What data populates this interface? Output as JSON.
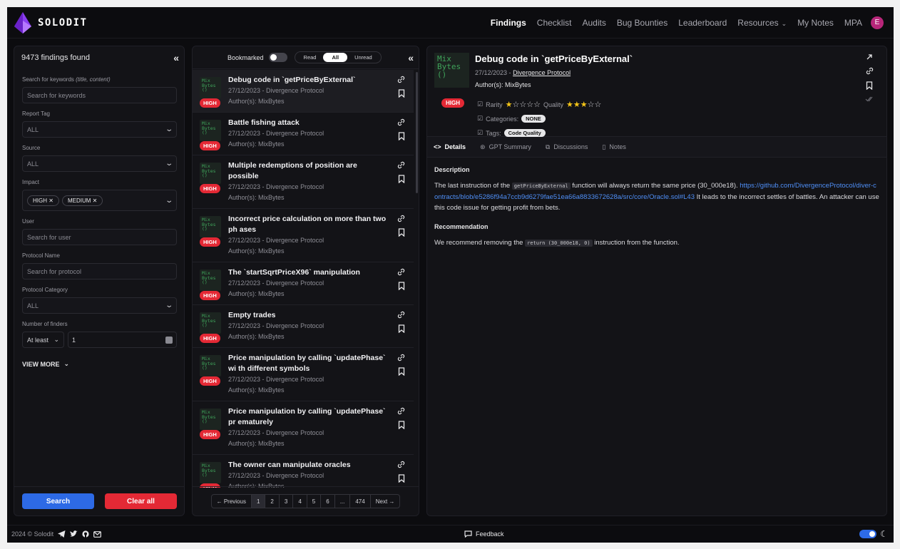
{
  "nav": {
    "brand": "SOLODIT",
    "items": [
      {
        "label": "Findings",
        "active": true
      },
      {
        "label": "Checklist"
      },
      {
        "label": "Audits"
      },
      {
        "label": "Bug Bounties"
      },
      {
        "label": "Leaderboard"
      },
      {
        "label": "Resources",
        "dropdown": true
      },
      {
        "label": "My Notes"
      },
      {
        "label": "MPA"
      }
    ],
    "avatar": "E"
  },
  "filters": {
    "count": "9473 findings found",
    "keywords_label": "Search for keywords",
    "keywords_hint": "(title, content)",
    "keywords_placeholder": "Search for keywords",
    "report_tag_label": "Report Tag",
    "report_tag_value": "ALL",
    "source_label": "Source",
    "source_value": "ALL",
    "impact_label": "Impact",
    "impact_chips": [
      "HIGH ✕",
      "MEDIUM ✕"
    ],
    "user_label": "User",
    "user_placeholder": "Search for user",
    "protocol_label": "Protocol Name",
    "protocol_placeholder": "Search for protocol",
    "category_label": "Protocol Category",
    "category_value": "ALL",
    "finders_label": "Number of finders",
    "finders_mode": "At least",
    "finders_value": "1",
    "view_more": "VIEW MORE",
    "search_button": "Search",
    "clear_button": "Clear all"
  },
  "list": {
    "bookmarked_label": "Bookmarked",
    "seg": [
      "Read",
      "All",
      "Unread"
    ],
    "logo_text": "Mix Bytes ()",
    "high_label": "HIGH",
    "rows": [
      {
        "title": "Debug code in `getPriceByExternal`",
        "date": "27/12/2023 - Divergence Protocol",
        "author": "Author(s): MixBytes"
      },
      {
        "title": "Battle fishing attack",
        "date": "27/12/2023 - Divergence Protocol",
        "author": "Author(s): MixBytes"
      },
      {
        "title": "Multiple redemptions of position are possible",
        "date": "27/12/2023 - Divergence Protocol",
        "author": "Author(s): MixBytes"
      },
      {
        "title": "Incorrect price calculation on more than two ph ases",
        "date": "27/12/2023 - Divergence Protocol",
        "author": "Author(s): MixBytes"
      },
      {
        "title": "The `startSqrtPriceX96` manipulation",
        "date": "27/12/2023 - Divergence Protocol",
        "author": "Author(s): MixBytes"
      },
      {
        "title": "Empty trades",
        "date": "27/12/2023 - Divergence Protocol",
        "author": "Author(s): MixBytes"
      },
      {
        "title": "Price manipulation by calling `updatePhase` wi th different symbols",
        "date": "27/12/2023 - Divergence Protocol",
        "author": "Author(s): MixBytes"
      },
      {
        "title": "Price manipulation by calling `updatePhase` pr ematurely",
        "date": "27/12/2023 - Divergence Protocol",
        "author": "Author(s): MixBytes"
      },
      {
        "title": "The owner can manipulate oracles",
        "date": "27/12/2023 - Divergence Protocol",
        "author": "Author(s): MixBytes"
      }
    ],
    "pager": {
      "prev": "← Previous",
      "pages": [
        "1",
        "2",
        "3",
        "4",
        "5",
        "6",
        "...",
        "474"
      ],
      "next": "Next →"
    }
  },
  "detail": {
    "logo_text": "Mix Bytes ()",
    "title": "Debug code in `getPriceByExternal`",
    "date": "27/12/2023 -",
    "protocol": "Divergence Protocol",
    "author": "Author(s): MixBytes",
    "impact": "HIGH",
    "rarity_label": "Rarity",
    "quality_label": "Quality",
    "rarity_stars": 1,
    "quality_stars": 3,
    "categories_label": "Categories:",
    "categories_value": "NONE",
    "tags_label": "Tags:",
    "tags_value": "Code Quality",
    "tabs": [
      "Details",
      "GPT Summary",
      "Discussions",
      "Notes"
    ],
    "description_heading": "Description",
    "description_pre": "The last instruction of the",
    "description_code": "getPriceByExternal",
    "description_mid": "function will always return the same price (30_000e18).",
    "description_link": "https://github.com/DivergenceProtocol/diver-contracts/blob/e5286f94a7ccb9d6279fae51ea66a8833672628a/src/core/Oracle.sol#L43",
    "description_post": "It leads to the incorrect settles of battles. An attacker can use this code issue for getting profit from bets.",
    "recommendation_heading": "Recommendation",
    "recommendation_pre": "We recommend removing the",
    "recommendation_code": "return (30_000e18, 0)",
    "recommendation_post": "instruction from the function."
  },
  "footer": {
    "copyright": "2024 © Solodit",
    "feedback": "Feedback"
  },
  "colors": {
    "accent": "#2d6ae6",
    "danger": "#e42935",
    "brand": "#8b3ff0",
    "star": "#f5c518"
  }
}
